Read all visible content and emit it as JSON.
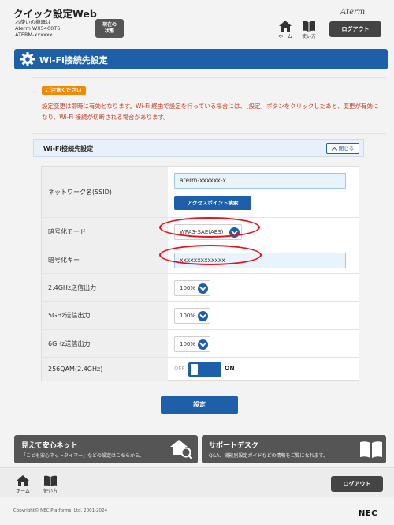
{
  "header": {
    "app_title": "クイック設定Web",
    "device_lines": [
      "お使いの機器は",
      "Aterm WX5400T6",
      "ATERM-xxxxxx"
    ],
    "status_button": [
      "現在の",
      "状態"
    ],
    "brand": "Aterm",
    "home_label": "ホーム",
    "help_label": "使い方",
    "logout_label": "ログアウト"
  },
  "page": {
    "title": "Wi-Fi接続先設定",
    "notice_badge": "ご注意ください",
    "notice_text": "設定変更は即時に有効となります。Wi-Fi 経由で設定を行っている場合には、［設定］ボタンをクリックしたあと、変更が有効になり、Wi-Fi 接続が切断される場合があります。"
  },
  "panel": {
    "title": "Wi-Fi接続先設定",
    "close_label": "閉じる",
    "rows": {
      "ssid_label": "ネットワーク名(SSID)",
      "ssid_value": "aterm-xxxxxx-x",
      "ap_search_label": "アクセスポイント検索",
      "enc_mode_label": "暗号化モード",
      "enc_mode_value": "WPA3-SAE(AES)",
      "enc_key_label": "暗号化キー",
      "enc_key_value": "xxxxxxxxxxxxx",
      "tx24_label": "2.4GHz送信出力",
      "tx24_value": "100%",
      "tx5_label": "5GHz送信出力",
      "tx5_value": "100%",
      "tx6_label": "6GHz送信出力",
      "tx6_value": "100%",
      "qam_label": "256QAM(2.4GHz)",
      "qam_off": "OFF",
      "qam_on": "ON"
    },
    "submit_label": "設定"
  },
  "banners": {
    "left_title": "見えて安心ネット",
    "left_sub": "「こども安心ネットタイマー」などの設定はこちらから。",
    "right_title": "サポートデスク",
    "right_sub": "Q&A、機能別設定ガイドなどの情報をご覧になれます。"
  },
  "footer": {
    "home_label": "ホーム",
    "help_label": "使い方",
    "logout_label": "ログアウト",
    "copyright": "Copyright© NEC Platforms, Ltd. 2001-2024",
    "nec": "NEC"
  },
  "colors": {
    "primary": "#1d5fa8",
    "notice": "#c23b22",
    "badge": "#f08a00",
    "highlight": "#e8101f"
  }
}
